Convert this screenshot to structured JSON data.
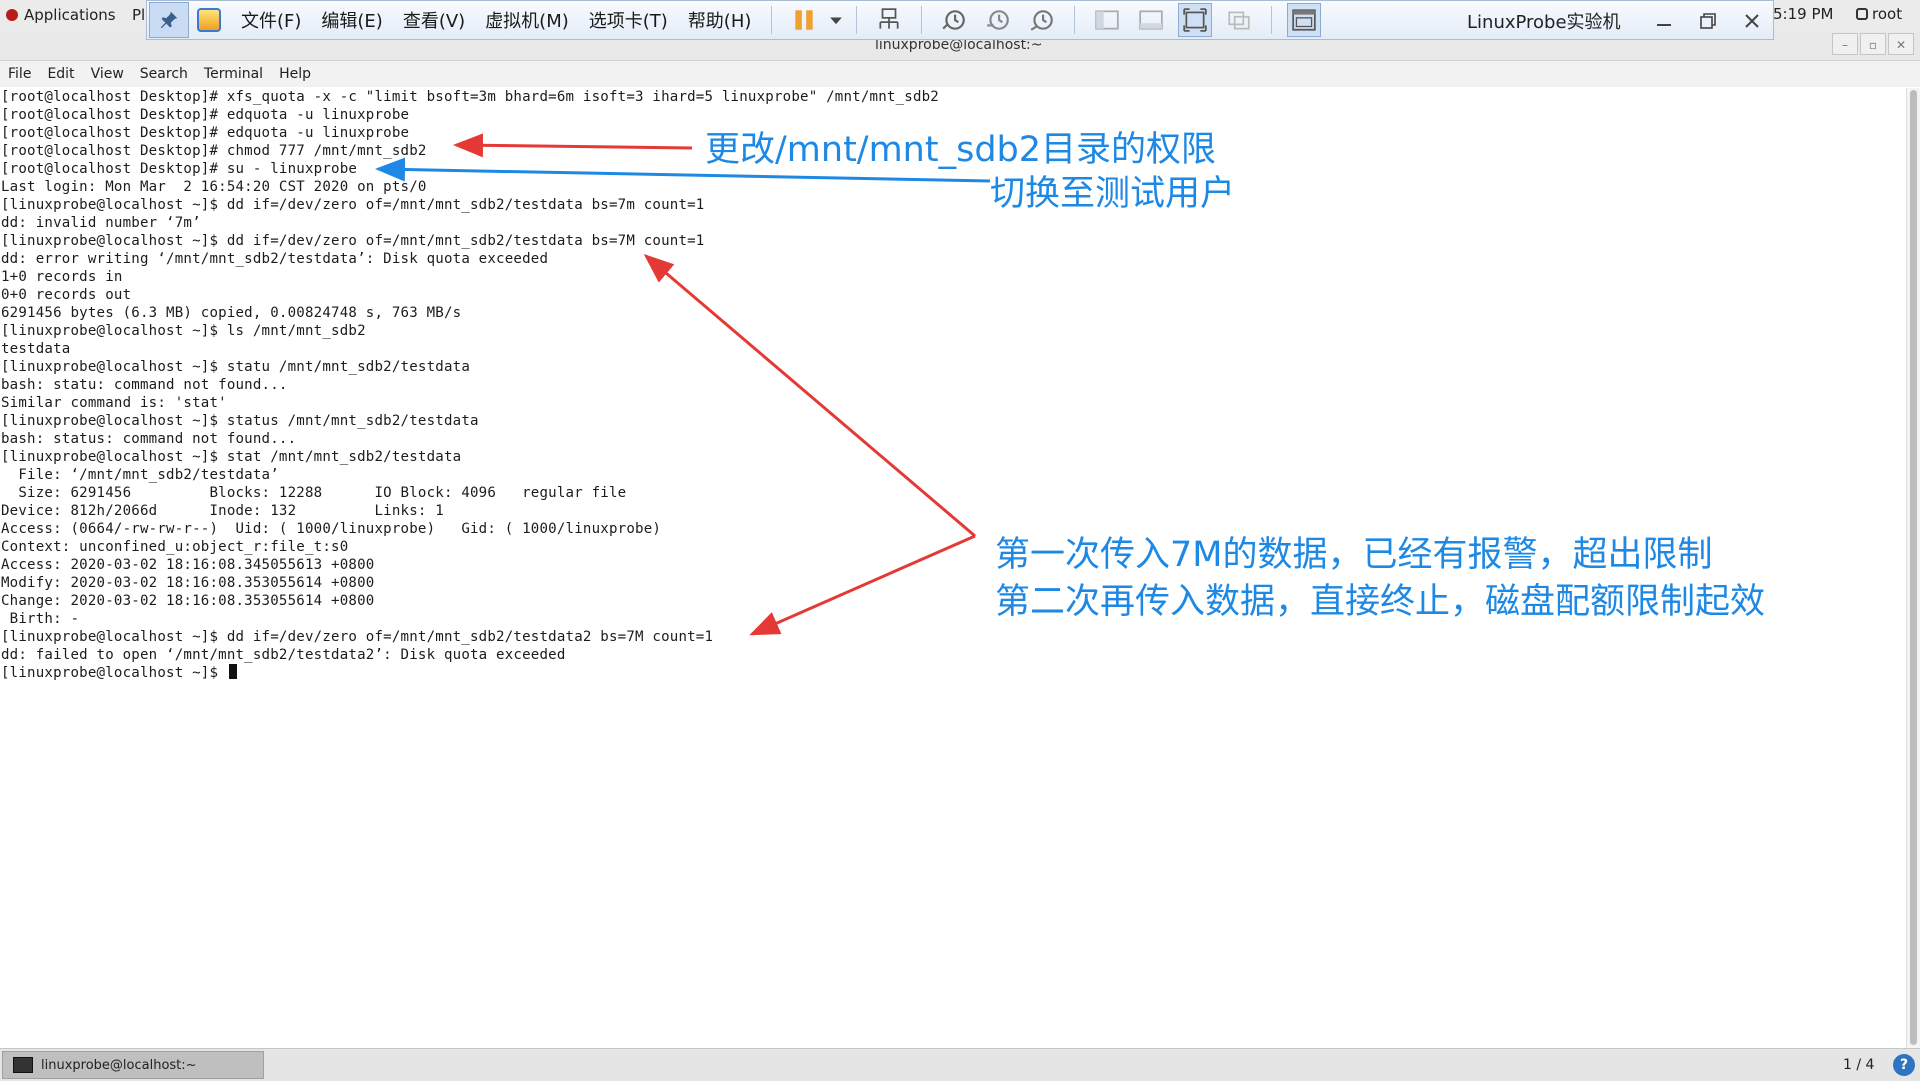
{
  "gnome_bar": {
    "applications": "Applications",
    "places_partial": "Pl",
    "clock_partial": "5:19 PM",
    "user": "root"
  },
  "vmware": {
    "menu": [
      "文件(F)",
      "编辑(E)",
      "查看(V)",
      "虚拟机(M)",
      "选项卡(T)",
      "帮助(H)"
    ],
    "title": "LinuxProbe实验机"
  },
  "terminal": {
    "window_title": "linuxprobe@localhost:~",
    "menu": [
      "File",
      "Edit",
      "View",
      "Search",
      "Terminal",
      "Help"
    ],
    "lines": [
      "[root@localhost Desktop]# xfs_quota -x -c \"limit bsoft=3m bhard=6m isoft=3 ihard=5 linuxprobe\" /mnt/mnt_sdb2",
      "[root@localhost Desktop]# edquota -u linuxprobe",
      "[root@localhost Desktop]# edquota -u linuxprobe",
      "[root@localhost Desktop]# chmod 777 /mnt/mnt_sdb2",
      "[root@localhost Desktop]# su - linuxprobe",
      "Last login: Mon Mar  2 16:54:20 CST 2020 on pts/0",
      "[linuxprobe@localhost ~]$ dd if=/dev/zero of=/mnt/mnt_sdb2/testdata bs=7m count=1",
      "dd: invalid number ‘7m’",
      "[linuxprobe@localhost ~]$ dd if=/dev/zero of=/mnt/mnt_sdb2/testdata bs=7M count=1",
      "dd: error writing ‘/mnt/mnt_sdb2/testdata’: Disk quota exceeded",
      "1+0 records in",
      "0+0 records out",
      "6291456 bytes (6.3 MB) copied, 0.00824748 s, 763 MB/s",
      "[linuxprobe@localhost ~]$ ls /mnt/mnt_sdb2",
      "testdata",
      "[linuxprobe@localhost ~]$ statu /mnt/mnt_sdb2/testdata",
      "bash: statu: command not found...",
      "Similar command is: 'stat'",
      "[linuxprobe@localhost ~]$ status /mnt/mnt_sdb2/testdata",
      "bash: status: command not found...",
      "[linuxprobe@localhost ~]$ stat /mnt/mnt_sdb2/testdata",
      "  File: ‘/mnt/mnt_sdb2/testdata’",
      "  Size: 6291456         Blocks: 12288      IO Block: 4096   regular file",
      "Device: 812h/2066d      Inode: 132         Links: 1",
      "Access: (0664/-rw-rw-r--)  Uid: ( 1000/linuxprobe)   Gid: ( 1000/linuxprobe)",
      "Context: unconfined_u:object_r:file_t:s0",
      "Access: 2020-03-02 18:16:08.345055613 +0800",
      "Modify: 2020-03-02 18:16:08.353055614 +0800",
      "Change: 2020-03-02 18:16:08.353055614 +0800",
      " Birth: -",
      "[linuxprobe@localhost ~]$ dd if=/dev/zero of=/mnt/mnt_sdb2/testdata2 bs=7M count=1",
      "dd: failed to open ‘/mnt/mnt_sdb2/testdata2’: Disk quota exceeded",
      "[linuxprobe@localhost ~]$ "
    ]
  },
  "annotations": {
    "chmod_note": "更改/mnt/mnt_sdb2目录的权限",
    "su_note": "切换至测试用户",
    "quota_note_1": "第一次传入7M的数据，已经有报警，超出限制",
    "quota_note_2": "第二次再传入数据，直接终止，磁盘配额限制起效"
  },
  "taskbar": {
    "task_label": "linuxprobe@localhost:~",
    "workspace": "1 / 4"
  },
  "colors": {
    "annotation_blue": "#1e88e5",
    "arrow_red": "#e53935",
    "arrow_blue": "#1e88e5"
  }
}
